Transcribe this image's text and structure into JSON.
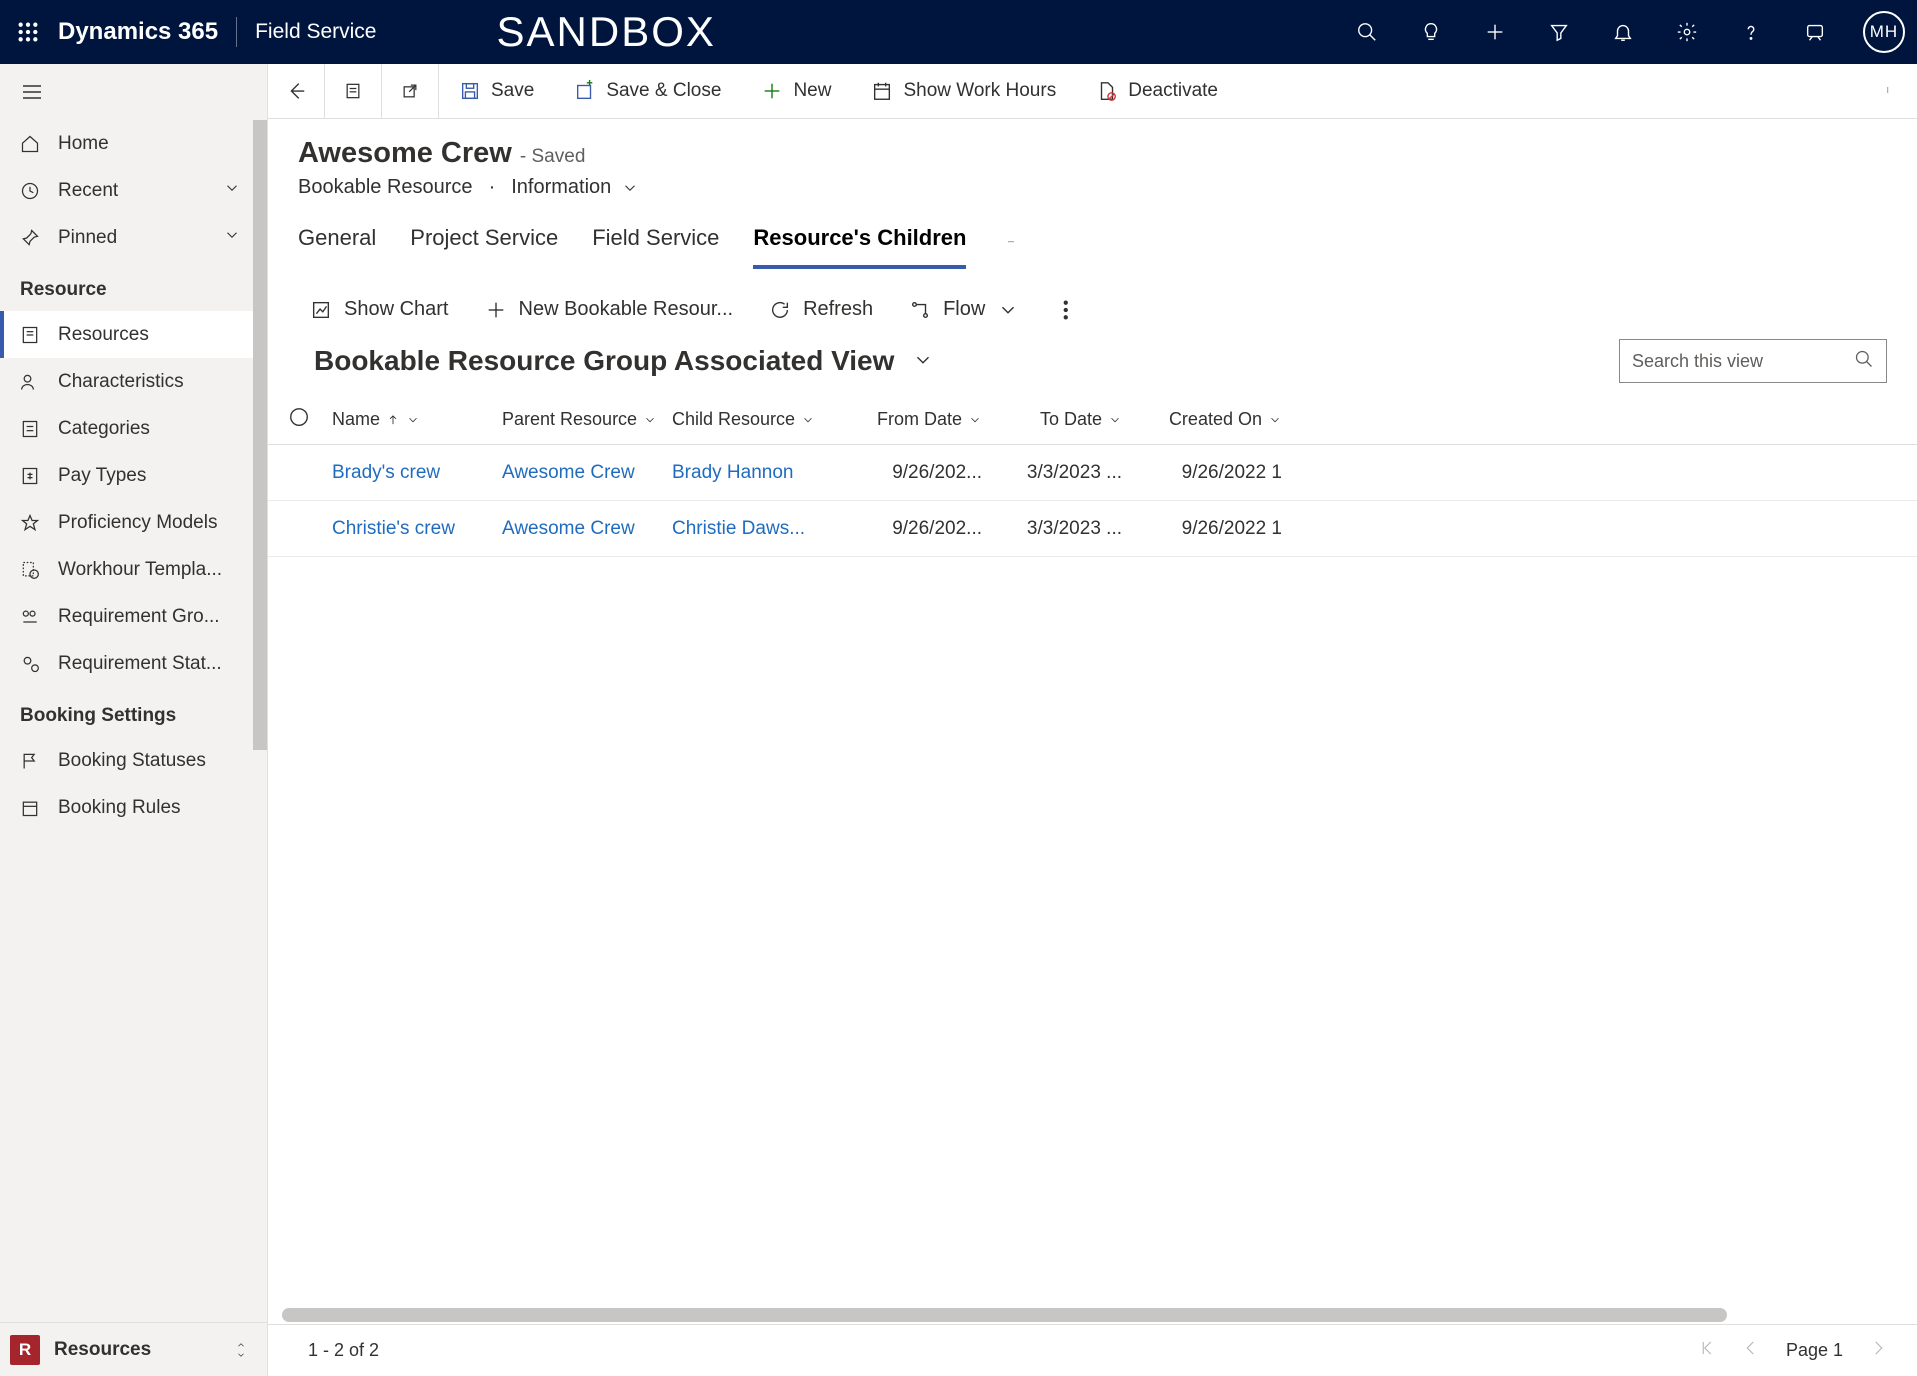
{
  "topnav": {
    "brand": "Dynamics 365",
    "app": "Field Service",
    "env": "SANDBOX",
    "avatar": "MH"
  },
  "sidebar": {
    "home": "Home",
    "recent": "Recent",
    "pinned": "Pinned",
    "section_resource": "Resource",
    "items_resource": [
      "Resources",
      "Characteristics",
      "Categories",
      "Pay Types",
      "Proficiency Models",
      "Workhour Templa...",
      "Requirement Gro...",
      "Requirement Stat..."
    ],
    "section_booking": "Booking Settings",
    "items_booking": [
      "Booking Statuses",
      "Booking Rules"
    ],
    "area": "Resources"
  },
  "commandbar": {
    "save": "Save",
    "saveclose": "Save & Close",
    "new": "New",
    "workhours": "Show Work Hours",
    "deactivate": "Deactivate"
  },
  "record": {
    "title": "Awesome Crew",
    "saved": "- Saved",
    "entity": "Bookable Resource",
    "view": "Information"
  },
  "tabs": [
    "General",
    "Project Service",
    "Field Service",
    "Resource's Children"
  ],
  "subgridcmd": {
    "showchart": "Show Chart",
    "new": "New Bookable Resour...",
    "refresh": "Refresh",
    "flow": "Flow"
  },
  "subgrid": {
    "view_title": "Bookable Resource Group Associated View",
    "search_placeholder": "Search this view",
    "columns": {
      "name": "Name",
      "parent": "Parent Resource",
      "child": "Child Resource",
      "from": "From Date",
      "to": "To Date",
      "created": "Created On"
    },
    "rows": [
      {
        "name": "Brady's crew",
        "parent": "Awesome Crew",
        "child": "Brady Hannon",
        "from": "9/26/202...",
        "to": "3/3/2023 ...",
        "created": "9/26/2022 1"
      },
      {
        "name": "Christie's crew",
        "parent": "Awesome Crew",
        "child": "Christie Daws...",
        "from": "9/26/202...",
        "to": "3/3/2023 ...",
        "created": "9/26/2022 1"
      }
    ]
  },
  "footer": {
    "count": "1 - 2 of 2",
    "page": "Page 1"
  }
}
